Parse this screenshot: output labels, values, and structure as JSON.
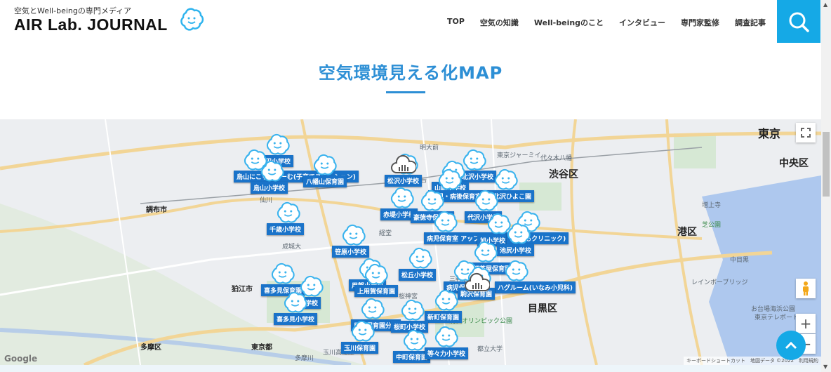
{
  "header": {
    "tagline": "空気とWell-beingの専門メディア",
    "logo": "AIR Lab. JOURNAL",
    "nav": [
      "TOP",
      "空気の知識",
      "Well-beingのこと",
      "インタビュー",
      "専門家監修",
      "調査記事"
    ]
  },
  "page_title": "空気環境見える化MAP",
  "map": {
    "districts": [
      "東京",
      "中央区",
      "渋谷区",
      "港区",
      "目黒区",
      "調布市",
      "狛江市",
      "多摩区",
      "東京都"
    ],
    "places": [
      "明大前",
      "下高井戸",
      "経堂",
      "成城大",
      "桜神宮",
      "三軒茶屋",
      "中目黒",
      "駒沢オリンピック公園",
      "都立大学",
      "芝公園",
      "増上寺",
      "東京ジャーミイ",
      "代々木八幡",
      "仙川",
      "多摩川",
      "玉川高島屋",
      "東京テレポート",
      "お台場海浜公園",
      "レインボーブリッジ"
    ],
    "markers": [
      "給田小学校",
      "烏山にこりんるーむ(子育てステーション)",
      "八幡山保育園",
      "烏山小学校",
      "千歳小学校",
      "松沢小学校",
      "下北沢小学校",
      "山崎小学校",
      "病児・病後保育室",
      "下北沢ひよこ園",
      "赤堤小学校",
      "豪徳寺保育園",
      "代沢小学校",
      "病児保育室 アップルキッズ",
      "旭小学校",
      "(こどもクリニック)",
      "池尻小学校",
      "笹原小学校",
      "三軒茶屋保育園",
      "松丘小学校",
      "用賀小学校",
      "上用賀保育園",
      "病児保育室",
      "ハグルーム(いなみ小児科)",
      "駒沢保育園",
      "喜多見保育園",
      "砧小学校",
      "喜多見小学校",
      "新町保育園",
      "用賀保育園分室",
      "桜町小学校",
      "玉川保育園",
      "中町保育園",
      "等々力小学校"
    ],
    "attribution": "キーボードショートカット　地図データ ©2022　利用規約",
    "google": "Google",
    "zoom_in": "+",
    "zoom_out": "−"
  },
  "colors": {
    "accent": "#15a9e6",
    "title": "#2d8fd5",
    "marker": "#1a73c9"
  }
}
